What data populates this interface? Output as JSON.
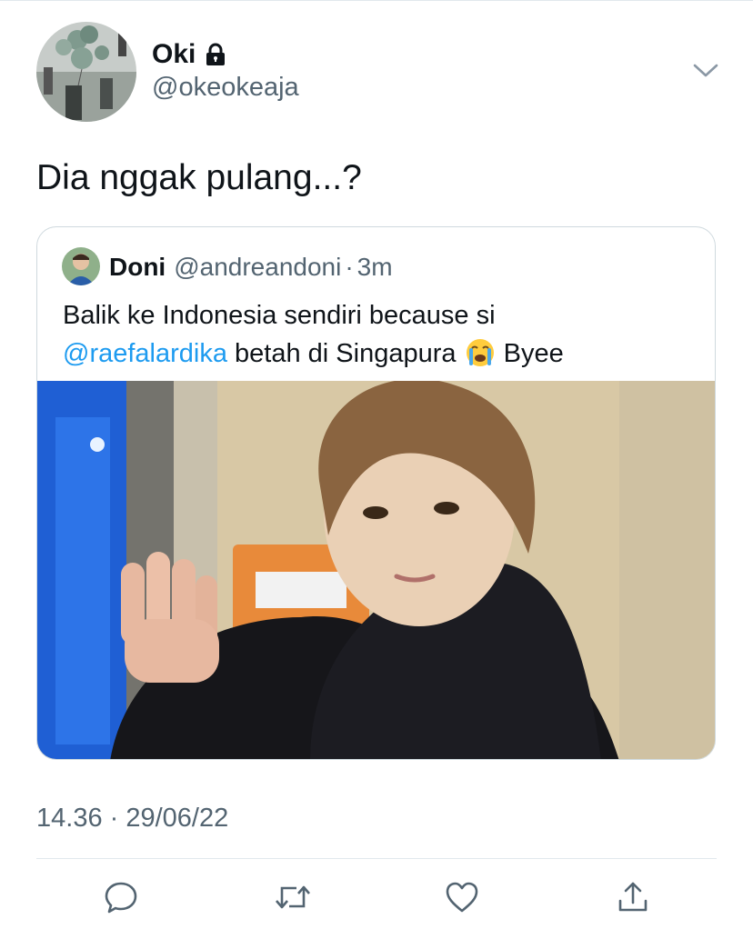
{
  "tweet": {
    "author": {
      "display_name": "Oki",
      "handle": "@okeokeaja",
      "protected_icon": "lock-icon"
    },
    "text": "Dia nggak pulang...?",
    "timestamp": "14.36 · 29/06/22",
    "menu_icon": "chevron-down-icon"
  },
  "quote": {
    "author": {
      "display_name": "Doni",
      "handle": "@andreandoni",
      "separator": "·",
      "time": "3m"
    },
    "text_line1": "Balik ke Indonesia sendiri because si",
    "mention": "@raefalardika",
    "text_after_mention": "betah di Singapura",
    "emoji_icon": "loudly-crying-face-icon",
    "text_end": "Byee",
    "media_icon": "photo"
  },
  "actions": [
    {
      "name": "reply",
      "icon": "reply-icon"
    },
    {
      "name": "retweet",
      "icon": "retweet-icon"
    },
    {
      "name": "like",
      "icon": "heart-icon"
    },
    {
      "name": "share",
      "icon": "share-icon"
    }
  ],
  "colors": {
    "accent": "#1d9bf0",
    "secondary_text": "#536471",
    "border": "#cfd9de"
  }
}
